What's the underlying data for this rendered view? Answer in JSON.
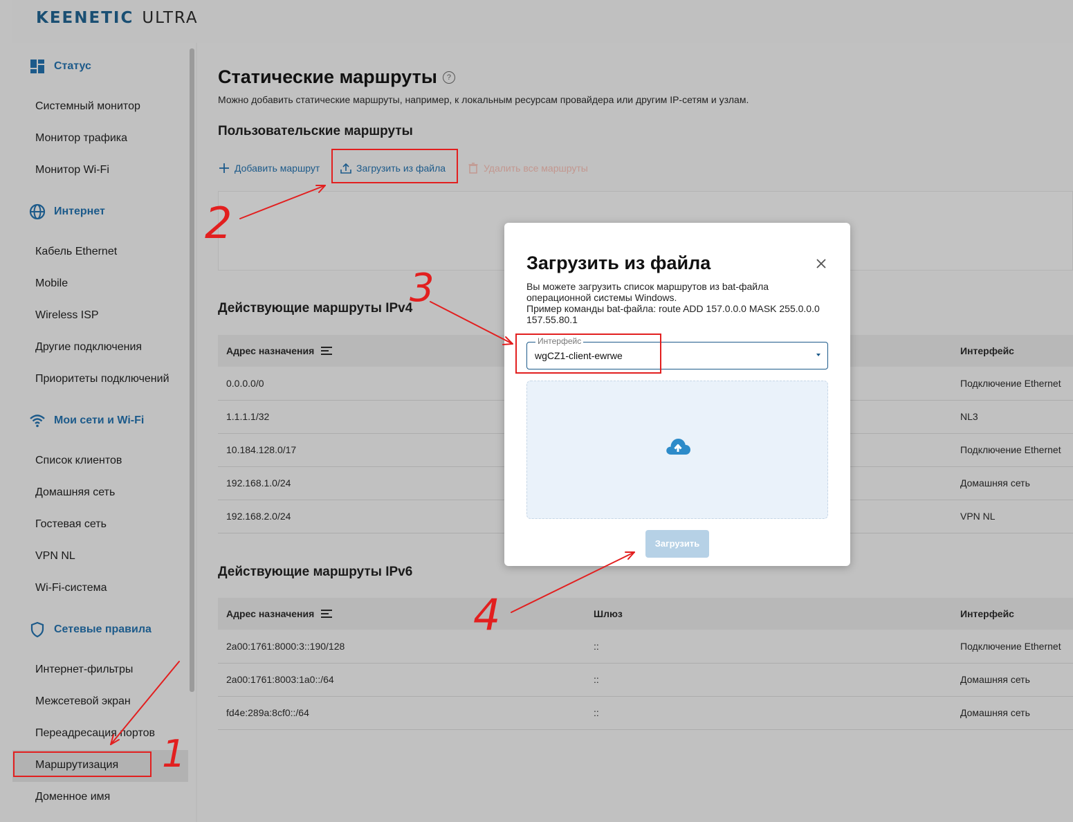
{
  "brand": {
    "part1": "KEENETIC",
    "part2": "ULTRA"
  },
  "sidebar": {
    "groups": [
      {
        "label": "Статус",
        "icon": "dashboard-icon"
      },
      {
        "label": "Интернет",
        "icon": "globe-icon"
      },
      {
        "label": "Мои сети и Wi-Fi",
        "icon": "wifi-icon"
      },
      {
        "label": "Сетевые правила",
        "icon": "shield-icon"
      }
    ],
    "items": [
      "Системный монитор",
      "Монитор трафика",
      "Монитор Wi-Fi",
      "Кабель Ethernet",
      "Mobile",
      "Wireless ISP",
      "Другие подключения",
      "Приоритеты подключений",
      "Список клиентов",
      "Домашняя сеть",
      "Гостевая сеть",
      "VPN NL",
      "Wi-Fi-система",
      "Интернет-фильтры",
      "Межсетевой экран",
      "Переадресация портов",
      "Маршрутизация",
      "Доменное имя"
    ]
  },
  "page": {
    "title": "Статические маршруты",
    "description": "Можно добавить статические маршруты, например, к локальным ресурсам провайдера или другим IP-сетям и узлам.",
    "user_routes_title": "Пользовательские маршруты",
    "actions": {
      "add": "Добавить маршрут",
      "upload": "Загрузить из файла",
      "delete_all": "Удалить все маршруты"
    },
    "ipv4": {
      "title": "Действующие маршруты IPv4",
      "columns": [
        "Адрес назначения",
        "Интерфейс"
      ],
      "rows": [
        {
          "dest": "0.0.0.0/0",
          "iface": "Подключение Ethernet"
        },
        {
          "dest": "1.1.1.1/32",
          "iface": "NL3"
        },
        {
          "dest": "10.184.128.0/17",
          "iface": "Подключение Ethernet"
        },
        {
          "dest": "192.168.1.0/24",
          "iface": "Домашняя сеть"
        },
        {
          "dest": "192.168.2.0/24",
          "iface": "VPN NL"
        }
      ]
    },
    "ipv6": {
      "title": "Действующие маршруты IPv6",
      "columns": [
        "Адрес назначения",
        "Шлюз",
        "Интерфейс"
      ],
      "rows": [
        {
          "dest": "2a00:1761:8000:3::190/128",
          "gw": "::",
          "iface": "Подключение Ethernet"
        },
        {
          "dest": "2a00:1761:8003:1a0::/64",
          "gw": "::",
          "iface": "Домашняя сеть"
        },
        {
          "dest": "fd4e:289a:8cf0::/64",
          "gw": "::",
          "iface": "Домашняя сеть"
        }
      ]
    }
  },
  "modal": {
    "title": "Загрузить из файла",
    "text_lines": [
      "Вы можете загрузить список маршрутов из bat-файла",
      "операционной системы Windows.",
      "Пример команды bat-файла: route ADD 157.0.0.0 MASK 255.0.0.0",
      "157.55.80.1"
    ],
    "field_label": "Интерфейс",
    "field_value": "wgCZ1-client-ewrwe",
    "upload_button": "Загрузить"
  },
  "annotations": [
    "1",
    "2",
    "3",
    "4"
  ],
  "colors": {
    "accent": "#1c5a8a",
    "annotation": "#e21f1f"
  }
}
